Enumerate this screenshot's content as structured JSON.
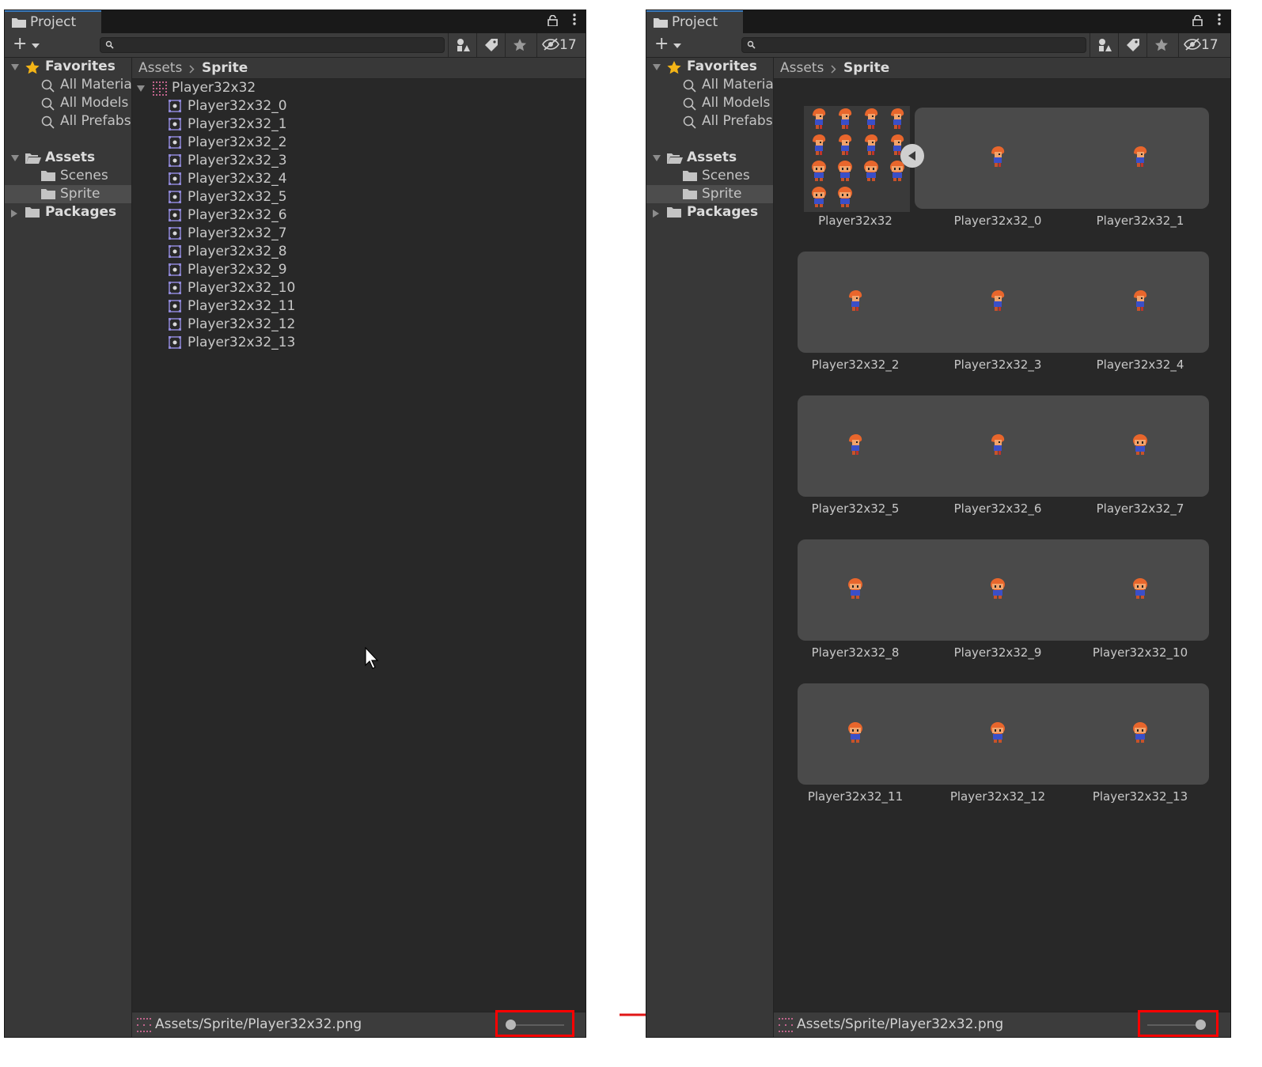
{
  "window": {
    "tab_title": "Project",
    "hidden_count": "17"
  },
  "sidebar": {
    "favorites_label": "Favorites",
    "favorites": [
      "All Materials",
      "All Models",
      "All Prefabs"
    ],
    "assets_label": "Assets",
    "asset_folders": [
      "Scenes",
      "Sprite"
    ],
    "selected_folder": "Sprite",
    "packages_label": "Packages"
  },
  "breadcrumb": {
    "root": "Assets",
    "current": "Sprite"
  },
  "list_view": {
    "parent_asset": "Player32x32",
    "sub_assets": [
      "Player32x32_0",
      "Player32x32_1",
      "Player32x32_2",
      "Player32x32_3",
      "Player32x32_4",
      "Player32x32_5",
      "Player32x32_6",
      "Player32x32_7",
      "Player32x32_8",
      "Player32x32_9",
      "Player32x32_10",
      "Player32x32_11",
      "Player32x32_12",
      "Player32x32_13"
    ]
  },
  "grid_view": {
    "items": [
      "Player32x32",
      "Player32x32_0",
      "Player32x32_1",
      "Player32x32_2",
      "Player32x32_3",
      "Player32x32_4",
      "Player32x32_5",
      "Player32x32_6",
      "Player32x32_7",
      "Player32x32_8",
      "Player32x32_9",
      "Player32x32_10",
      "Player32x32_11",
      "Player32x32_12",
      "Player32x32_13"
    ]
  },
  "status": {
    "path": "Assets/Sprite/Player32x32.png"
  },
  "zoom": {
    "left_level": 0.0,
    "right_level": 1.0
  },
  "colors": {
    "highlight": "#ff0000",
    "accent": "#3a79bb",
    "star": "#f4b517"
  }
}
